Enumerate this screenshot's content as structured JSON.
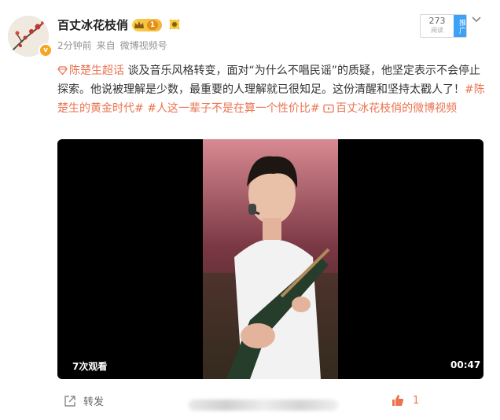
{
  "post": {
    "username": "百丈冰花枝俏",
    "vip_level": "1",
    "time": "2分钟前",
    "source_prefix": "来自",
    "source": "微博视频号",
    "recommend": {
      "count": "273",
      "count_label": "阅读",
      "tag": "推广"
    },
    "topic_link": "陈楚生超话",
    "body_text_1": " 谈及音乐风格转变，面对“为什么不唱民谣”的质疑，他坚定表示不会停止探索。他说被理解是少数，最重要的人理解就已很知足。这份清醒和坚持太戳人了！",
    "hashtag_1": "#陈楚生的黄金时代#",
    "hashtag_2": "#人这一辈子不是在算一个性价比#",
    "video_link": "百丈冰花枝俏的微博视频"
  },
  "video": {
    "views": "7次观看",
    "duration": "00:47"
  },
  "footer": {
    "repost_label": "转发",
    "like_count": "1"
  },
  "colors": {
    "link": "#eb7350",
    "accent_blue": "#3da1f5",
    "vip_gold": "#f3b33b"
  }
}
